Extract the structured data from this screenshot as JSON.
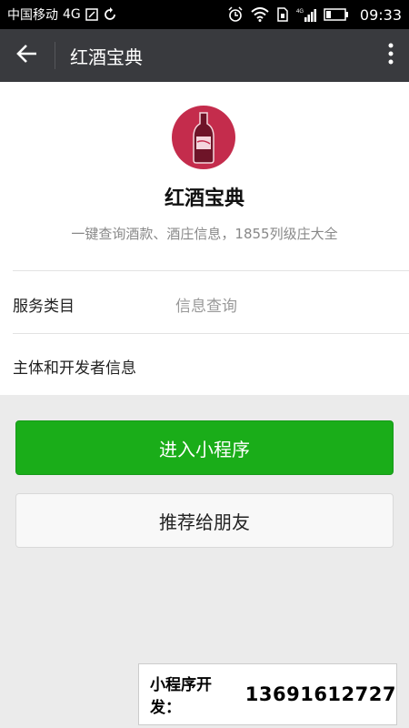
{
  "status_bar": {
    "carrier": "中国移动",
    "network": "4G",
    "time": "09:33"
  },
  "header": {
    "title": "红酒宝典"
  },
  "app": {
    "name": "红酒宝典",
    "description": "一键查询酒款、酒庄信息，1855列级庄大全",
    "rows": [
      {
        "label": "服务类目",
        "value": "信息查询"
      },
      {
        "label": "主体和开发者信息",
        "value": ""
      }
    ]
  },
  "buttons": {
    "enter": "进入小程序",
    "share": "推荐给朋友"
  },
  "contact": {
    "label": "小程序开发：",
    "phone": "13691612727"
  },
  "colors": {
    "accent_green": "#1aad19",
    "header_bg": "#393a3e",
    "logo_bg": "#c42c4c"
  }
}
